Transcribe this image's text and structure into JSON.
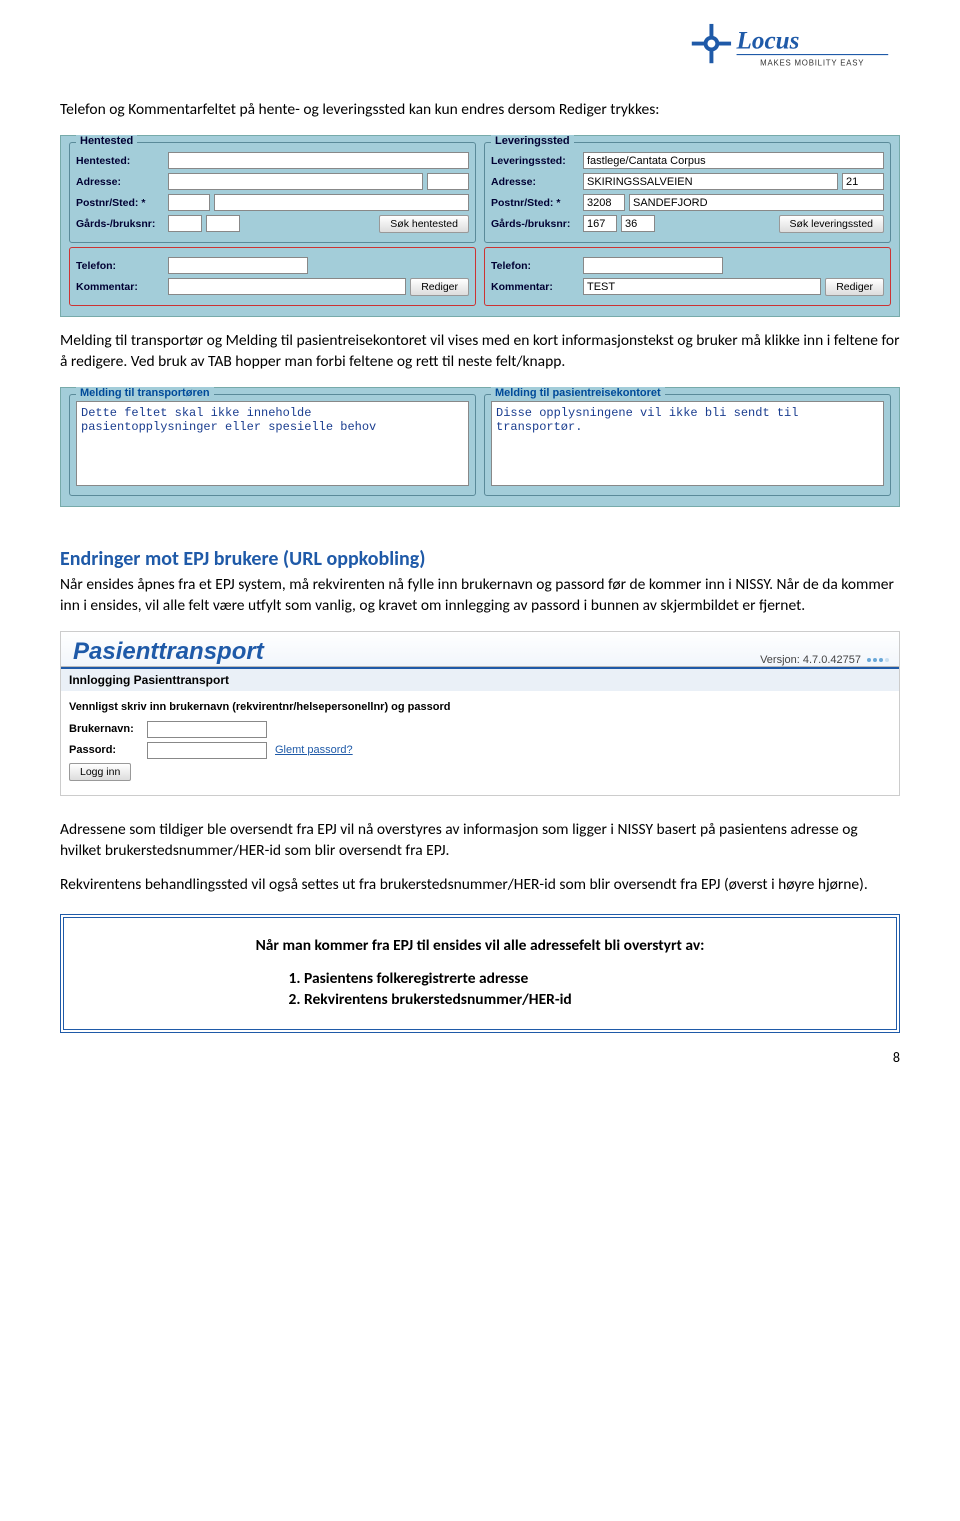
{
  "logo": {
    "word": "Locus",
    "tag": "MAKES MOBILITY EASY"
  },
  "p1": "Telefon og Kommentarfeltet på hente- og leveringssted kan kun endres dersom Rediger trykkes:",
  "panel1": {
    "left": {
      "title": "Hentested",
      "hentested_label": "Hentested:",
      "adresse_label": "Adresse:",
      "postnr_label": "Postnr/Sted: *",
      "gards_label": "Gårds-/bruksnr:",
      "sok_btn": "Søk hentested",
      "telefon_label": "Telefon:",
      "kommentar_label": "Kommentar:",
      "rediger_btn": "Rediger",
      "hentested_val": "",
      "adresse_val": "",
      "adresse2_val": "",
      "postnr_val": "",
      "sted_val": "",
      "gards1_val": "",
      "gards2_val": "",
      "telefon_val": "",
      "kommentar_val": ""
    },
    "right": {
      "title": "Leveringssted",
      "leveringssted_label": "Leveringssted:",
      "adresse_label": "Adresse:",
      "postnr_label": "Postnr/Sted: *",
      "gards_label": "Gårds-/bruksnr:",
      "sok_btn": "Søk leveringssted",
      "telefon_label": "Telefon:",
      "kommentar_label": "Kommentar:",
      "rediger_btn": "Rediger",
      "leveringssted_val": "fastlege/Cantata Corpus",
      "adresse_val": "SKIRINGSSALVEIEN",
      "adresse2_val": "21",
      "postnr_val": "3208",
      "sted_val": "SANDEFJORD",
      "gards1_val": "167",
      "gards2_val": "36",
      "telefon_val": "",
      "kommentar_val": "TEST"
    }
  },
  "p2": "Melding til transportør og Melding til pasientreisekontoret vil vises med en kort informasjonstekst og bruker må klikke inn i feltene for å redigere. Ved bruk av TAB hopper man forbi feltene og rett til neste felt/knapp.",
  "panel2": {
    "left_title": "Melding til transportøren",
    "right_title": "Melding til pasientreisekontoret",
    "left_text": "Dette feltet skal ikke inneholde\npasientopplysninger eller spesielle behov",
    "right_text": "Disse opplysningene vil ikke bli sendt til\ntransportør."
  },
  "h2": "Endringer mot EPJ brukere (URL oppkobling)",
  "p3": "Når ensides åpnes fra et EPJ system, må rekvirenten nå fylle inn brukernavn og passord før de kommer inn i NISSY. Når de da kommer inn i ensides, vil alle felt være utfylt som vanlig, og kravet om innlegging av passord i bunnen av skjermbildet er fjernet.",
  "app": {
    "title": "Pasienttransport",
    "version": "Versjon: 4.7.0.42757",
    "login_heading": "Innlogging Pasienttransport",
    "login_text": "Vennligst skriv inn brukernavn (rekvirentnr/helsepersonellnr) og passord",
    "bruker_label": "Brukernavn:",
    "passord_label": "Passord:",
    "glemt": "Glemt passord?",
    "login_btn": "Logg inn"
  },
  "p4": "Adressene som tildiger ble oversendt fra EPJ vil nå overstyres av informasjon som ligger i NISSY basert på pasientens adresse og hvilket brukerstedsnummer/HER-id som blir oversendt fra EPJ.",
  "p5": "Rekvirentens behandlingssted vil også settes ut fra brukerstedsnummer/HER-id som blir oversendt fra EPJ (øverst i høyre hjørne).",
  "box": {
    "line": "Når man kommer fra EPJ til ensides vil alle adressefelt bli overstyrt av:",
    "item1": "Pasientens folkeregistrerte adresse",
    "item2": "Rekvirentens brukerstedsnummer/HER-id"
  },
  "pagenum": "8"
}
